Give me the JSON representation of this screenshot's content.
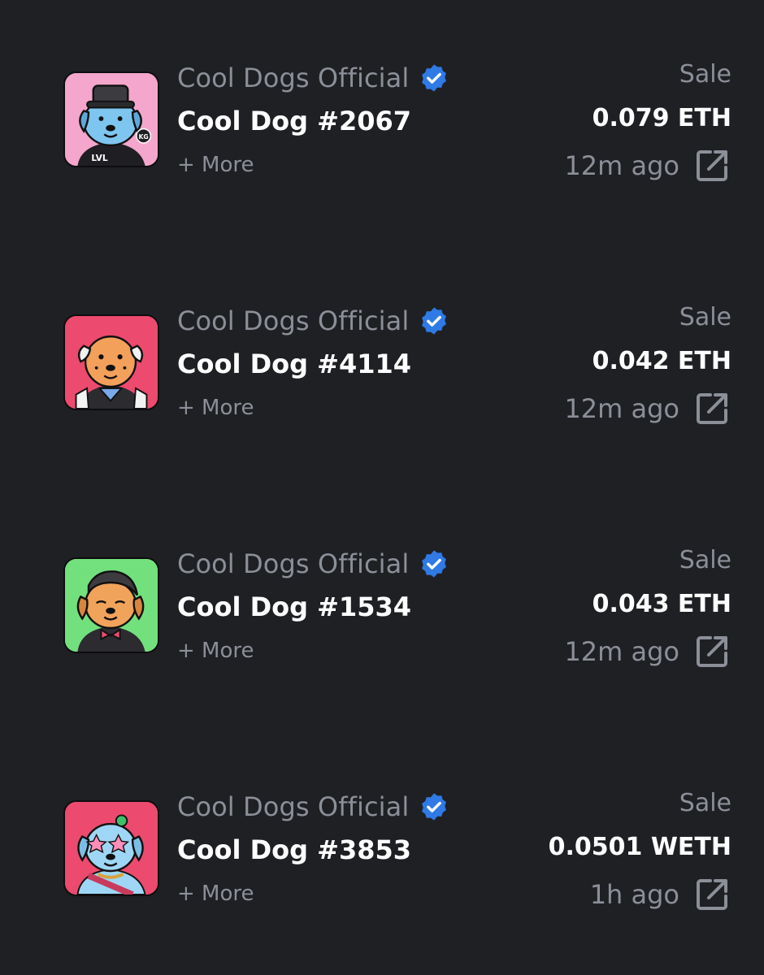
{
  "colors": {
    "background": "#1f2024",
    "muted_text": "#8b8f98",
    "primary_text": "#ffffff",
    "verified_badge": "#2f7ae5"
  },
  "rows": [
    {
      "collection": "Cool Dogs Official",
      "name": "Cool Dog #2067",
      "more": "+ More",
      "event": "Sale",
      "price": "0.079 ETH",
      "time": "12m ago",
      "icons": {
        "verified": "verified-badge-icon",
        "link": "external-link-icon"
      },
      "thumb": {
        "bg": "#f4a6cc",
        "dog_color": "#7ec5ef",
        "badge_text_a": "LVL",
        "badge_text_b": "KG"
      }
    },
    {
      "collection": "Cool Dogs Official",
      "name": "Cool Dog #4114",
      "more": "+ More",
      "event": "Sale",
      "price": "0.042 ETH",
      "time": "12m ago",
      "icons": {
        "verified": "verified-badge-icon",
        "link": "external-link-icon"
      },
      "thumb": {
        "bg": "#ec4a6e",
        "dog_color": "#f3a05a"
      }
    },
    {
      "collection": "Cool Dogs Official",
      "name": "Cool Dog #1534",
      "more": "+ More",
      "event": "Sale",
      "price": "0.043 ETH",
      "time": "12m ago",
      "icons": {
        "verified": "verified-badge-icon",
        "link": "external-link-icon"
      },
      "thumb": {
        "bg": "#73e07e",
        "dog_color": "#f0a35a"
      }
    },
    {
      "collection": "Cool Dogs Official",
      "name": "Cool Dog #3853",
      "more": "+ More",
      "event": "Sale",
      "price": "0.0501 WETH",
      "time": "1h ago",
      "icons": {
        "verified": "verified-badge-icon",
        "link": "external-link-icon"
      },
      "thumb": {
        "bg": "#ec4a6e",
        "dog_color": "#9ed7f5"
      }
    }
  ]
}
